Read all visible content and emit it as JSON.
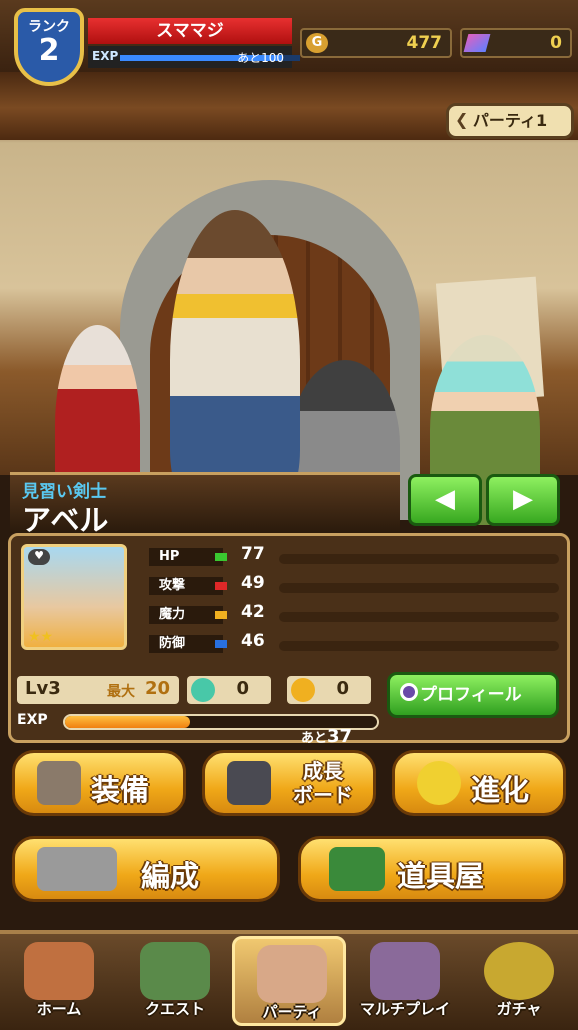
{
  "header": {
    "rank_label": "ランク",
    "rank_value": "2",
    "player_name": "スママジ",
    "exp_label": "EXP",
    "exp_remaining": "あと100",
    "exp_progress": 0.9,
    "gold_icon": "G",
    "gold_value": "477",
    "gem_value": "0"
  },
  "party_selector": {
    "label": "パーティ1"
  },
  "character": {
    "job": "見習い剣士",
    "name": "アベル",
    "prev_arrow": "◀",
    "next_arrow": "▶",
    "rarity_stars": "★★",
    "stats": [
      {
        "label": "HP",
        "value": "77",
        "color": "#3ac830"
      },
      {
        "label": "攻撃",
        "value": "49",
        "color": "#e02828"
      },
      {
        "label": "魔力",
        "value": "42",
        "color": "#f0b020"
      },
      {
        "label": "防御",
        "value": "46",
        "color": "#2870e0"
      }
    ],
    "level": "Lv3",
    "max_label": "最大",
    "max_value": "20",
    "star_count": "0",
    "medal_count": "0",
    "profile_button": "プロフィール",
    "exp_label": "EXP",
    "exp_progress": 0.4,
    "exp_remaining_prefix": "あと",
    "exp_remaining_value": "37"
  },
  "actions": {
    "equip": "装備",
    "growth_board_line1": "成長",
    "growth_board_line2": "ボード",
    "evolve": "進化",
    "formation": "編成",
    "item_shop": "道具屋"
  },
  "nav": {
    "home": "ホーム",
    "quest": "クエスト",
    "party": "パーティ",
    "multiplay": "マルチプレイ",
    "gacha": "ガチャ"
  }
}
